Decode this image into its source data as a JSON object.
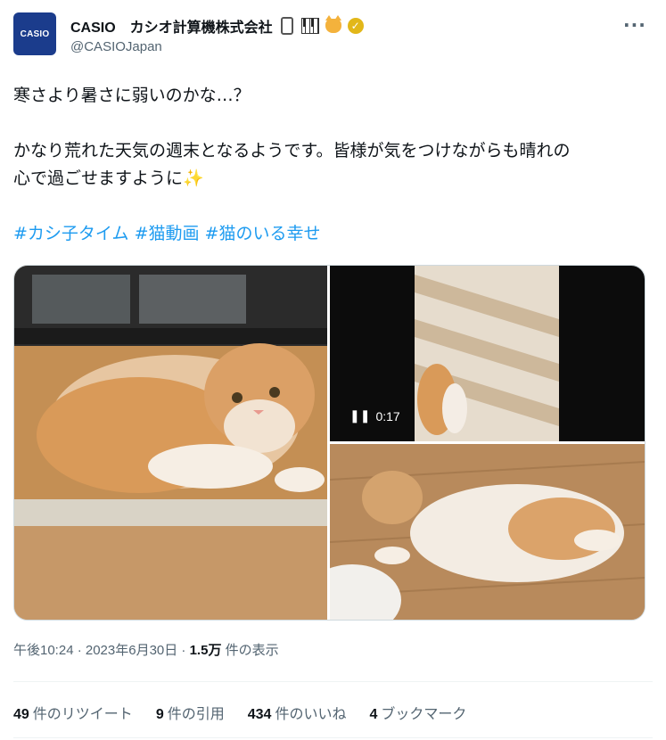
{
  "author": {
    "avatar_text": "CASIO",
    "display_name": "CASIO　カシオ計算機株式会社",
    "handle": "@CASIOJapan",
    "brand_color": "#1b3c8c",
    "name_icons": [
      "watch-icon",
      "piano-keys-icon",
      "cat-face-icon",
      "verified-badge-icon"
    ]
  },
  "tweet": {
    "line1": "寒さより暑さに弱いのかな…？",
    "line2": "かなり荒れた天気の週末となるようです。皆様が気をつけながらも晴れの",
    "line3": "心で過ごせますように",
    "sparkle": "✨",
    "hashtags": "#カシ子タイム #猫動画 #猫のいる幸せ"
  },
  "media": {
    "video_duration": "0:17",
    "pause_icon": "pause-icon"
  },
  "meta": {
    "time": "午後10:24 · 2023年6月30日 · ",
    "views_count": "1.5万",
    "views_label": " 件の表示"
  },
  "stats": {
    "retweets_count": "49",
    "retweets_label": "件のリツイート",
    "quotes_count": "9",
    "quotes_label": "件の引用",
    "likes_count": "434",
    "likes_label": "件のいいね",
    "bookmarks_count": "4",
    "bookmarks_label": "ブックマーク"
  },
  "colors": {
    "link": "#1d9bf0",
    "muted": "#536471",
    "text": "#0f1419"
  }
}
